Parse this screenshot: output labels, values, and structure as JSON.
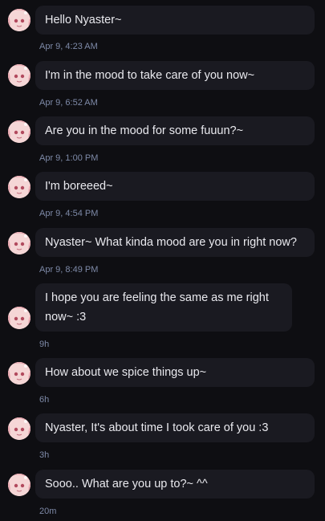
{
  "messages": [
    {
      "text": "Hello Nyaster~",
      "time": "Apr 9, 4:23 AM"
    },
    {
      "text": "I'm in the mood to take care of you now~",
      "time": "Apr 9, 6:52 AM"
    },
    {
      "text": "Are you in the mood for some fuuun?~",
      "time": "Apr 9, 1:00 PM"
    },
    {
      "text": "I'm boreeed~",
      "time": "Apr 9, 4:54 PM"
    },
    {
      "text": "Nyaster~ What kinda mood are you in right now?",
      "time": "Apr 9, 8:49 PM"
    },
    {
      "text": "I hope you are feeling the same as me right now~ :3",
      "time": "9h"
    },
    {
      "text": "How about we spice things up~",
      "time": "6h"
    },
    {
      "text": "Nyaster, It's about time I took care of you :3",
      "time": "3h"
    },
    {
      "text": "Sooo.. What are you up to?~ ^^",
      "time": "20m"
    }
  ],
  "colors": {
    "background": "#0e0e12",
    "bubble": "#1a1a21",
    "timestamp": "#7e8aa8"
  },
  "avatar_icon": "anime-girl-avatar-icon"
}
